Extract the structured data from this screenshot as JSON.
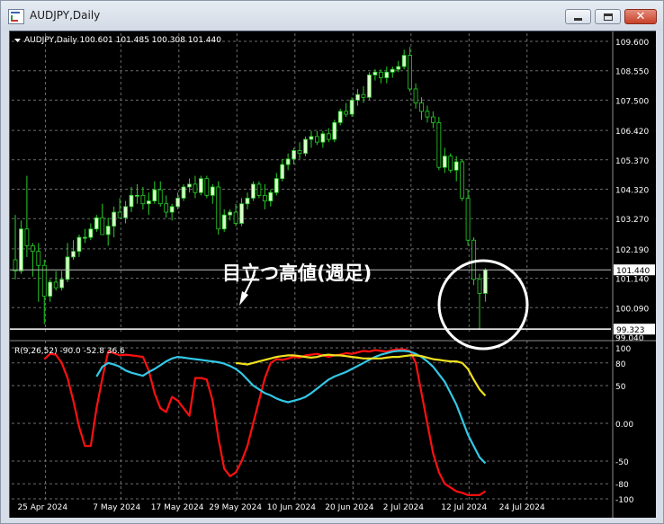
{
  "window": {
    "title": "AUDJPY,Daily",
    "close_glyph": "✕"
  },
  "chart_info": "AUDJPY,Daily  100.601 101.485 100.308 101.440",
  "annotation": "目立つ高値(週足)",
  "colors": {
    "background": "#000000",
    "bull_candle": "#d8ffc8",
    "bear_candle": "#000000",
    "candle_wick": "#26d026",
    "grid": "#6b6b6b",
    "rci_short": "#ff1010",
    "rci_mid": "#33c8e6",
    "rci_long": "#f0e020",
    "annotation_circle": "#ffffff",
    "annotation_text": "#ffffff"
  },
  "chart_data": [
    {
      "type": "candlestick",
      "symbol": "AUDJPY",
      "timeframe": "Daily",
      "price_ticks": [
        "109.600",
        "108.550",
        "107.500",
        "106.420",
        "105.370",
        "104.320",
        "103.270",
        "102.190",
        "101.140",
        "100.090",
        "99.040"
      ],
      "ylim": [
        99.04,
        109.6
      ],
      "last_price_label": "101.440",
      "marked_price_label": "99.323",
      "last_price": 101.44,
      "marked_price": 99.323,
      "date_labels": [
        "25 Apr 2024",
        "7 May 2024",
        "17 May 2024",
        "29 May 2024",
        "10 Jun 2024",
        "20 Jun 2024",
        "2 Jul 2024",
        "12 Jul 2024",
        "24 Jul 2024"
      ],
      "date_label_candle_index": [
        1,
        14,
        24,
        34,
        44,
        54,
        64,
        74,
        84
      ],
      "ohlc": [
        [
          101.8,
          103.4,
          101.1,
          101.4
        ],
        [
          101.4,
          103.2,
          101.3,
          102.9
        ],
        [
          102.9,
          104.8,
          101.9,
          102.3
        ],
        [
          102.3,
          102.4,
          101.2,
          102.1
        ],
        [
          102.1,
          102.4,
          100.3,
          101.6
        ],
        [
          101.6,
          101.8,
          99.5,
          100.5
        ],
        [
          100.5,
          101.1,
          100.3,
          101.0
        ],
        [
          101.0,
          101.4,
          100.7,
          100.8
        ],
        [
          100.8,
          101.4,
          100.7,
          101.1
        ],
        [
          101.1,
          102.4,
          101.0,
          101.9
        ],
        [
          101.9,
          102.5,
          101.8,
          102.1
        ],
        [
          102.1,
          102.7,
          101.9,
          102.6
        ],
        [
          102.6,
          102.9,
          102.4,
          102.6
        ],
        [
          102.6,
          103.1,
          102.5,
          102.9
        ],
        [
          102.9,
          103.4,
          102.8,
          103.3
        ],
        [
          103.3,
          103.8,
          102.7,
          102.7
        ],
        [
          102.7,
          103.3,
          102.3,
          103.0
        ],
        [
          103.0,
          103.7,
          102.6,
          103.5
        ],
        [
          103.5,
          104.0,
          103.3,
          103.3
        ],
        [
          103.3,
          103.9,
          103.1,
          103.7
        ],
        [
          103.7,
          104.4,
          103.5,
          104.1
        ],
        [
          104.1,
          104.5,
          103.8,
          104.1
        ],
        [
          104.1,
          104.4,
          103.6,
          103.8
        ],
        [
          103.8,
          104.2,
          103.4,
          103.9
        ],
        [
          103.9,
          104.6,
          103.8,
          104.3
        ],
        [
          104.3,
          104.6,
          103.7,
          103.8
        ],
        [
          103.8,
          104.1,
          103.3,
          103.5
        ],
        [
          103.5,
          103.8,
          103.2,
          103.7
        ],
        [
          103.7,
          104.2,
          103.6,
          104.0
        ],
        [
          104.0,
          104.5,
          103.9,
          104.4
        ],
        [
          104.4,
          104.7,
          104.2,
          104.5
        ],
        [
          104.5,
          104.8,
          104.0,
          104.2
        ],
        [
          104.2,
          104.8,
          104.1,
          104.7
        ],
        [
          104.7,
          104.8,
          104.0,
          104.1
        ],
        [
          104.1,
          104.5,
          103.8,
          104.4
        ],
        [
          104.4,
          104.6,
          102.7,
          102.9
        ],
        [
          102.9,
          103.6,
          102.8,
          103.4
        ],
        [
          103.4,
          103.6,
          103.2,
          103.5
        ],
        [
          103.5,
          103.8,
          103.0,
          103.1
        ],
        [
          103.1,
          104.0,
          103.0,
          103.8
        ],
        [
          103.8,
          104.2,
          103.6,
          104.0
        ],
        [
          104.0,
          104.6,
          103.9,
          104.5
        ],
        [
          104.5,
          104.6,
          104.0,
          104.1
        ],
        [
          104.1,
          104.5,
          103.6,
          103.9
        ],
        [
          103.9,
          104.3,
          103.7,
          104.2
        ],
        [
          104.2,
          104.9,
          104.1,
          104.7
        ],
        [
          104.7,
          105.4,
          104.6,
          105.2
        ],
        [
          105.2,
          105.6,
          105.0,
          105.4
        ],
        [
          105.4,
          105.8,
          105.2,
          105.7
        ],
        [
          105.7,
          106.0,
          105.4,
          105.6
        ],
        [
          105.6,
          106.2,
          105.5,
          106.1
        ],
        [
          106.1,
          106.4,
          105.8,
          106.2
        ],
        [
          106.2,
          106.4,
          105.9,
          106.0
        ],
        [
          106.0,
          106.4,
          105.8,
          106.3
        ],
        [
          106.3,
          106.5,
          106.0,
          106.1
        ],
        [
          106.1,
          106.8,
          106.0,
          106.7
        ],
        [
          106.7,
          107.2,
          106.6,
          107.1
        ],
        [
          107.1,
          107.4,
          106.9,
          107.0
        ],
        [
          107.0,
          107.6,
          106.9,
          107.5
        ],
        [
          107.5,
          107.9,
          107.3,
          107.7
        ],
        [
          107.7,
          108.0,
          107.4,
          107.6
        ],
        [
          107.6,
          108.5,
          107.5,
          108.4
        ],
        [
          108.4,
          108.6,
          108.2,
          108.5
        ],
        [
          108.5,
          108.6,
          108.1,
          108.3
        ],
        [
          108.3,
          108.7,
          108.1,
          108.5
        ],
        [
          108.5,
          108.7,
          108.3,
          108.6
        ],
        [
          108.6,
          108.9,
          108.5,
          108.7
        ],
        [
          108.7,
          109.3,
          108.6,
          109.1
        ],
        [
          109.1,
          109.4,
          107.8,
          107.9
        ],
        [
          107.9,
          108.1,
          107.2,
          107.4
        ],
        [
          107.4,
          107.6,
          106.8,
          107.1
        ],
        [
          107.1,
          107.3,
          106.7,
          106.9
        ],
        [
          106.9,
          107.1,
          106.5,
          106.7
        ],
        [
          106.7,
          106.9,
          105.0,
          105.1
        ],
        [
          105.1,
          105.8,
          104.9,
          105.5
        ],
        [
          105.5,
          105.6,
          104.9,
          105.0
        ],
        [
          105.0,
          105.5,
          104.6,
          105.3
        ],
        [
          105.3,
          105.4,
          103.9,
          104.0
        ],
        [
          104.0,
          104.3,
          102.3,
          102.5
        ],
        [
          102.5,
          102.6,
          100.9,
          101.1
        ],
        [
          101.1,
          101.3,
          99.3,
          100.6
        ],
        [
          100.6,
          101.5,
          100.3,
          101.44
        ]
      ]
    },
    {
      "type": "line",
      "title": "R(9,26,52) -90.0 -52.8 36.6",
      "y_ticks": [
        "100",
        "80",
        "50",
        "0.00",
        "-50",
        "-80",
        "-100"
      ],
      "ylim": [
        -100,
        100
      ],
      "series": [
        {
          "key": "short",
          "color": "#ff1010",
          "values": [
            85,
            92,
            91,
            80,
            60,
            30,
            -5,
            -30,
            -30,
            20,
            60,
            95,
            93,
            90,
            91,
            90,
            89,
            88,
            70,
            40,
            20,
            15,
            35,
            30,
            20,
            10,
            60,
            60,
            58,
            30,
            -20,
            -60,
            -70,
            -65,
            -50,
            -30,
            0,
            30,
            60,
            80,
            85,
            84,
            86,
            88,
            87,
            90,
            91,
            92,
            90,
            88,
            90,
            91,
            93,
            92,
            94,
            96,
            95,
            97,
            96,
            95,
            97,
            98,
            98,
            96,
            80,
            40,
            0,
            -40,
            -65,
            -80,
            -85,
            -90,
            -92,
            -95,
            -95,
            -95,
            -90
          ]
        },
        {
          "key": "mid",
          "color": "#33c8e6",
          "values": [
            62,
            75,
            80,
            78,
            75,
            70,
            67,
            65,
            63,
            68,
            72,
            77,
            82,
            86,
            88,
            87,
            86,
            85,
            84,
            83,
            82,
            81,
            79,
            76,
            72,
            66,
            58,
            50,
            45,
            40,
            37,
            33,
            30,
            28,
            30,
            32,
            35,
            40,
            46,
            52,
            58,
            62,
            65,
            68,
            72,
            76,
            80,
            84,
            88,
            91,
            93,
            95,
            96,
            96,
            95,
            92,
            88,
            82,
            75,
            65,
            55,
            40,
            25,
            5,
            -15,
            -30,
            -45,
            -52.8
          ]
        },
        {
          "key": "long",
          "color": "#f0e020",
          "values": [
            80,
            79,
            78,
            80,
            82,
            84,
            86,
            88,
            89,
            90,
            90,
            89,
            88,
            87,
            88,
            90,
            91,
            90,
            90,
            89,
            88,
            87,
            86,
            86,
            86,
            86,
            87,
            88,
            88,
            89,
            90,
            90,
            89,
            87,
            85,
            84,
            83,
            82,
            82,
            80,
            72,
            58,
            45,
            36.6
          ]
        }
      ]
    }
  ]
}
